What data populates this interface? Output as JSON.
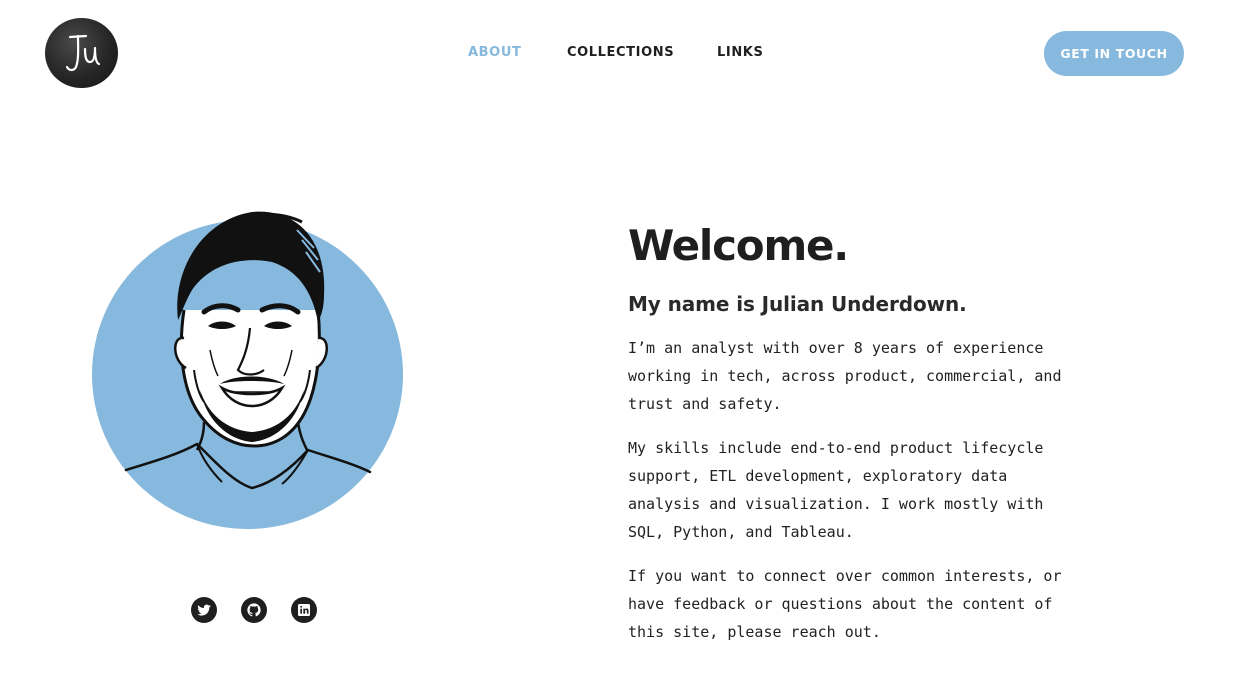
{
  "header": {
    "logo_text": "JU",
    "nav": [
      {
        "label": "ABOUT",
        "active": true
      },
      {
        "label": "COLLECTIONS",
        "active": false
      },
      {
        "label": "LINKS",
        "active": false
      }
    ],
    "cta_label": "GET IN TOUCH"
  },
  "main": {
    "title": "Welcome.",
    "subtitle": "My name is Julian Underdown.",
    "paragraphs": [
      "I’m an analyst with over 8 years of experience working in tech, across product, commercial, and trust and safety.",
      "My skills include end-to-end product lifecycle support, ETL development, exploratory data analysis and visualization. I work mostly with SQL, Python, and Tableau.",
      "If you want to connect over common interests, or have feedback or questions about the content of this site, please reach out."
    ]
  },
  "social": [
    {
      "icon": "twitter-icon"
    },
    {
      "icon": "github-icon"
    },
    {
      "icon": "linkedin-icon"
    }
  ],
  "colors": {
    "accent": "#86b9dd",
    "text": "#1f1f1f",
    "background": "#ffffff"
  }
}
